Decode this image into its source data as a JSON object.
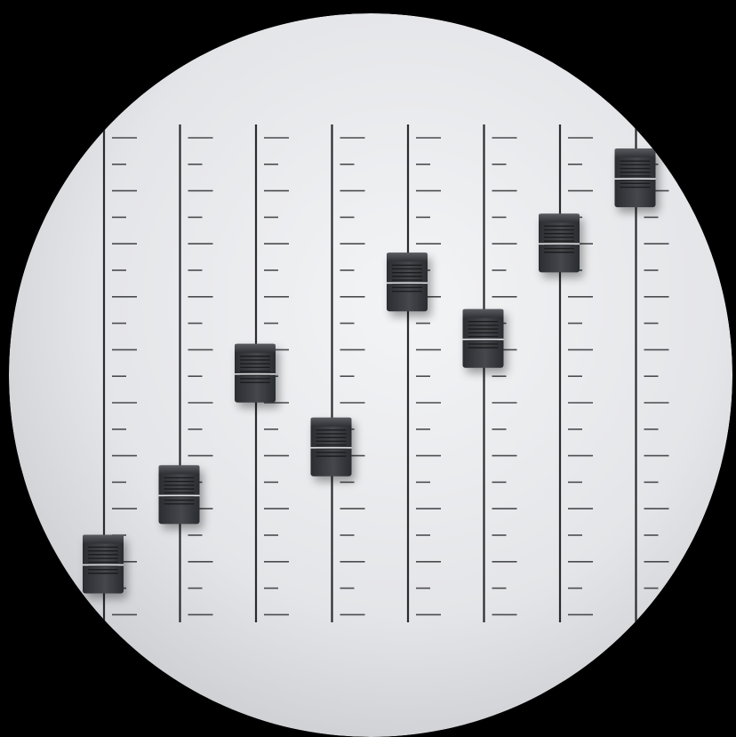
{
  "scene": {
    "subject": "mixing-console-faders",
    "background_color": "#000000",
    "panel_color": "#e9eaed",
    "track_color": "#2a2b2e",
    "tick_color": "#2f3033",
    "knob_color": "#3a3c40",
    "knob_highlight": "#e6e7ea"
  },
  "faders": [
    {
      "name": "fader-1",
      "level": 0.04
    },
    {
      "name": "fader-2",
      "level": 0.2
    },
    {
      "name": "fader-3",
      "level": 0.48
    },
    {
      "name": "fader-4",
      "level": 0.31
    },
    {
      "name": "fader-5",
      "level": 0.69
    },
    {
      "name": "fader-6",
      "level": 0.56
    },
    {
      "name": "fader-7",
      "level": 0.78
    },
    {
      "name": "fader-8",
      "level": 0.93
    }
  ]
}
